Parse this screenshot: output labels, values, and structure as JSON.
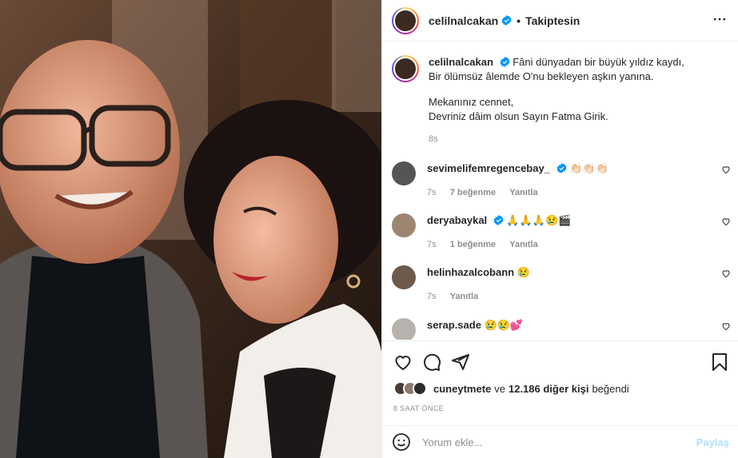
{
  "post": {
    "username": "celilnalcakan",
    "follow_status": "Takiptesin",
    "separator": "•",
    "more_label": "•••"
  },
  "caption": {
    "username": "celilnalcakan",
    "line1": "Fâni dünyadan bir büyük yıldız kaydı,",
    "line2": "Bir ölümsüz âlemde O'nu bekleyen aşkın yanına.",
    "line3": "Mekanınız cennet,",
    "line4": "Devriniz dâim olsun Sayın Fatma Girik.",
    "time": "8s"
  },
  "comments": [
    {
      "username": "sevimelifemregencebay_",
      "text": "👏🏻👏🏻👏🏻",
      "time": "7s",
      "likes": "7 beğenme",
      "reply": "Yanıtla",
      "verified": true
    },
    {
      "username": "deryabaykal",
      "text": "🙏🙏🙏😢🎬",
      "time": "7s",
      "likes": "1 beğenme",
      "reply": "Yanıtla",
      "verified": true
    },
    {
      "username": "helinhazalcobann",
      "text": "😢",
      "time": "7s",
      "likes": "",
      "reply": "Yanıtla",
      "verified": false
    },
    {
      "username": "serap.sade",
      "text": "😢😢💕",
      "time": "",
      "likes": "",
      "reply": "",
      "verified": false
    }
  ],
  "likes": {
    "first_user": "cuneytmete",
    "connector": "ve",
    "others": "12.186 diğer kişi",
    "suffix": "beğendi"
  },
  "timestamp": "8 SAAT ÖNCE",
  "composer": {
    "placeholder": "Yorum ekle...",
    "post_label": "Paylaş"
  },
  "colors": {
    "verified": "#0095f6",
    "muted": "#8e8e8e",
    "post_disabled": "#b2dffc"
  },
  "icons": [
    "heart-icon",
    "comment-icon",
    "share-icon",
    "bookmark-icon",
    "emoji-icon",
    "more-icon",
    "verified-icon"
  ]
}
